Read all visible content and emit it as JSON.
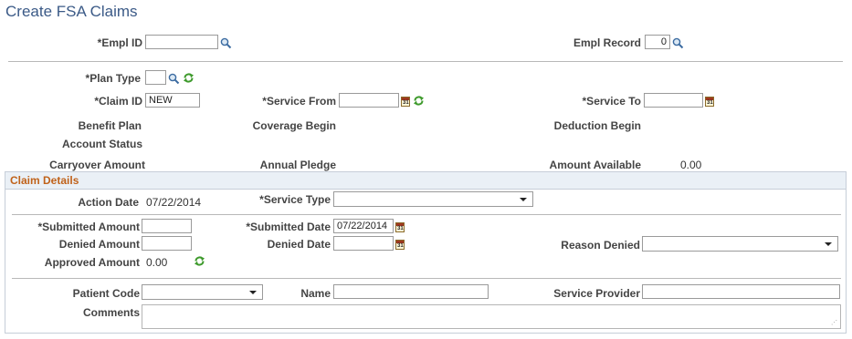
{
  "page": {
    "title": "Create FSA Claims"
  },
  "header": {
    "empl_id_label": "*Empl ID",
    "empl_id_value": "",
    "empl_record_label": "Empl Record",
    "empl_record_value": "0"
  },
  "claim": {
    "plan_type_label": "*Plan Type",
    "plan_type_value": "",
    "claim_id_label": "*Claim ID",
    "claim_id_value": "NEW",
    "service_from_label": "*Service From",
    "service_from_value": "",
    "service_to_label": "*Service To",
    "service_to_value": "",
    "benefit_plan_label": "Benefit Plan",
    "coverage_begin_label": "Coverage Begin",
    "deduction_begin_label": "Deduction Begin",
    "account_status_label": "Account Status",
    "carryover_label": "Carryover Amount",
    "annual_pledge_label": "Annual Pledge",
    "amount_available_label": "Amount Available",
    "amount_available_value": "0.00"
  },
  "details": {
    "section_title": "Claim Details",
    "action_date_label": "Action Date",
    "action_date_value": "07/22/2014",
    "service_type_label": "*Service Type",
    "service_type_value": "",
    "submitted_amount_label": "*Submitted Amount",
    "submitted_amount_value": "",
    "submitted_date_label": "*Submitted Date",
    "submitted_date_value": "07/22/2014",
    "denied_amount_label": "Denied Amount",
    "denied_amount_value": "",
    "denied_date_label": "Denied Date",
    "denied_date_value": "",
    "reason_denied_label": "Reason Denied",
    "reason_denied_value": "",
    "approved_amount_label": "Approved Amount",
    "approved_amount_value": "0.00",
    "patient_code_label": "Patient Code",
    "patient_code_value": "",
    "name_label": "Name",
    "name_value": "",
    "service_provider_label": "Service Provider",
    "service_provider_value": "",
    "comments_label": "Comments",
    "comments_value": ""
  },
  "icons": {
    "lookup": "magnifier-icon",
    "refresh": "refresh-icon",
    "calendar": "calendar-icon",
    "calendar_day": "31"
  }
}
